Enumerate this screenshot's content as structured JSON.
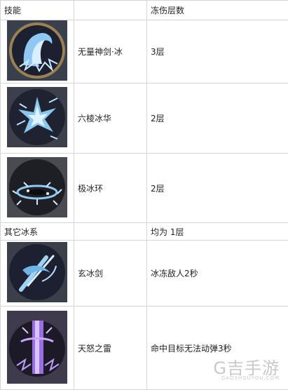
{
  "header": {
    "col1": "技能",
    "col2": "",
    "col3": "冻伤层数"
  },
  "rows": [
    {
      "icon": "ice-waterfall-icon",
      "name": "无量神剑·冰",
      "value": "3层"
    },
    {
      "icon": "ice-crystal-burst-icon",
      "name": "六棱冰华",
      "value": "2层"
    },
    {
      "icon": "ice-ring-icon",
      "name": "极冰环",
      "value": "2层"
    }
  ],
  "section": {
    "label": "其它冰系",
    "value": "均为 1层"
  },
  "rows2": [
    {
      "icon": "ice-sword-icon",
      "name": "玄冰剑",
      "value": "冰冻敌人2秒"
    },
    {
      "icon": "purple-thunder-icon",
      "name": "天怒之雷",
      "value": "命中目标无法动弹3秒"
    }
  ],
  "watermark": {
    "text": "G吉手游",
    "sub": "GAOSHOUYOU.COM"
  }
}
